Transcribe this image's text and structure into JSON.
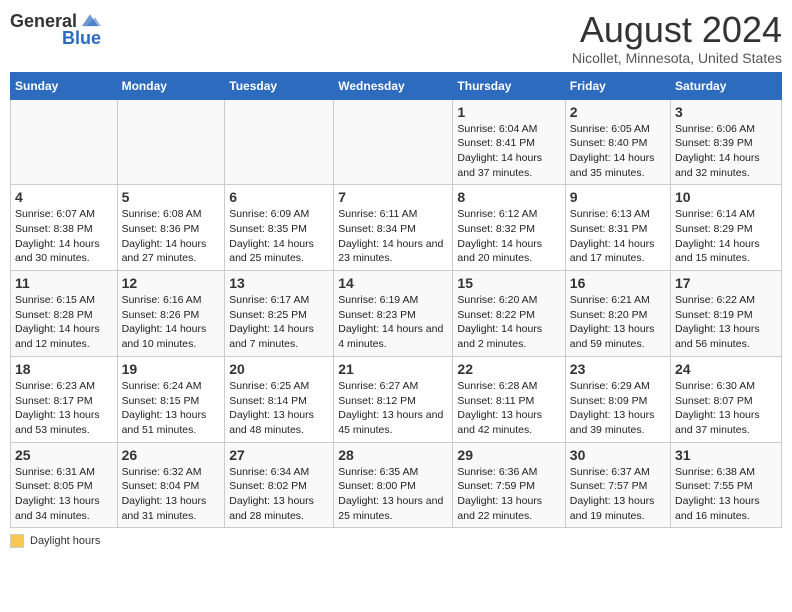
{
  "header": {
    "logo_general": "General",
    "logo_blue": "Blue",
    "title": "August 2024",
    "subtitle": "Nicollet, Minnesota, United States"
  },
  "days_of_week": [
    "Sunday",
    "Monday",
    "Tuesday",
    "Wednesday",
    "Thursday",
    "Friday",
    "Saturday"
  ],
  "weeks": [
    [
      {
        "day": "",
        "info": ""
      },
      {
        "day": "",
        "info": ""
      },
      {
        "day": "",
        "info": ""
      },
      {
        "day": "",
        "info": ""
      },
      {
        "day": "1",
        "info": "Sunrise: 6:04 AM\nSunset: 8:41 PM\nDaylight: 14 hours and 37 minutes."
      },
      {
        "day": "2",
        "info": "Sunrise: 6:05 AM\nSunset: 8:40 PM\nDaylight: 14 hours and 35 minutes."
      },
      {
        "day": "3",
        "info": "Sunrise: 6:06 AM\nSunset: 8:39 PM\nDaylight: 14 hours and 32 minutes."
      }
    ],
    [
      {
        "day": "4",
        "info": "Sunrise: 6:07 AM\nSunset: 8:38 PM\nDaylight: 14 hours and 30 minutes."
      },
      {
        "day": "5",
        "info": "Sunrise: 6:08 AM\nSunset: 8:36 PM\nDaylight: 14 hours and 27 minutes."
      },
      {
        "day": "6",
        "info": "Sunrise: 6:09 AM\nSunset: 8:35 PM\nDaylight: 14 hours and 25 minutes."
      },
      {
        "day": "7",
        "info": "Sunrise: 6:11 AM\nSunset: 8:34 PM\nDaylight: 14 hours and 23 minutes."
      },
      {
        "day": "8",
        "info": "Sunrise: 6:12 AM\nSunset: 8:32 PM\nDaylight: 14 hours and 20 minutes."
      },
      {
        "day": "9",
        "info": "Sunrise: 6:13 AM\nSunset: 8:31 PM\nDaylight: 14 hours and 17 minutes."
      },
      {
        "day": "10",
        "info": "Sunrise: 6:14 AM\nSunset: 8:29 PM\nDaylight: 14 hours and 15 minutes."
      }
    ],
    [
      {
        "day": "11",
        "info": "Sunrise: 6:15 AM\nSunset: 8:28 PM\nDaylight: 14 hours and 12 minutes."
      },
      {
        "day": "12",
        "info": "Sunrise: 6:16 AM\nSunset: 8:26 PM\nDaylight: 14 hours and 10 minutes."
      },
      {
        "day": "13",
        "info": "Sunrise: 6:17 AM\nSunset: 8:25 PM\nDaylight: 14 hours and 7 minutes."
      },
      {
        "day": "14",
        "info": "Sunrise: 6:19 AM\nSunset: 8:23 PM\nDaylight: 14 hours and 4 minutes."
      },
      {
        "day": "15",
        "info": "Sunrise: 6:20 AM\nSunset: 8:22 PM\nDaylight: 14 hours and 2 minutes."
      },
      {
        "day": "16",
        "info": "Sunrise: 6:21 AM\nSunset: 8:20 PM\nDaylight: 13 hours and 59 minutes."
      },
      {
        "day": "17",
        "info": "Sunrise: 6:22 AM\nSunset: 8:19 PM\nDaylight: 13 hours and 56 minutes."
      }
    ],
    [
      {
        "day": "18",
        "info": "Sunrise: 6:23 AM\nSunset: 8:17 PM\nDaylight: 13 hours and 53 minutes."
      },
      {
        "day": "19",
        "info": "Sunrise: 6:24 AM\nSunset: 8:15 PM\nDaylight: 13 hours and 51 minutes."
      },
      {
        "day": "20",
        "info": "Sunrise: 6:25 AM\nSunset: 8:14 PM\nDaylight: 13 hours and 48 minutes."
      },
      {
        "day": "21",
        "info": "Sunrise: 6:27 AM\nSunset: 8:12 PM\nDaylight: 13 hours and 45 minutes."
      },
      {
        "day": "22",
        "info": "Sunrise: 6:28 AM\nSunset: 8:11 PM\nDaylight: 13 hours and 42 minutes."
      },
      {
        "day": "23",
        "info": "Sunrise: 6:29 AM\nSunset: 8:09 PM\nDaylight: 13 hours and 39 minutes."
      },
      {
        "day": "24",
        "info": "Sunrise: 6:30 AM\nSunset: 8:07 PM\nDaylight: 13 hours and 37 minutes."
      }
    ],
    [
      {
        "day": "25",
        "info": "Sunrise: 6:31 AM\nSunset: 8:05 PM\nDaylight: 13 hours and 34 minutes."
      },
      {
        "day": "26",
        "info": "Sunrise: 6:32 AM\nSunset: 8:04 PM\nDaylight: 13 hours and 31 minutes."
      },
      {
        "day": "27",
        "info": "Sunrise: 6:34 AM\nSunset: 8:02 PM\nDaylight: 13 hours and 28 minutes."
      },
      {
        "day": "28",
        "info": "Sunrise: 6:35 AM\nSunset: 8:00 PM\nDaylight: 13 hours and 25 minutes."
      },
      {
        "day": "29",
        "info": "Sunrise: 6:36 AM\nSunset: 7:59 PM\nDaylight: 13 hours and 22 minutes."
      },
      {
        "day": "30",
        "info": "Sunrise: 6:37 AM\nSunset: 7:57 PM\nDaylight: 13 hours and 19 minutes."
      },
      {
        "day": "31",
        "info": "Sunrise: 6:38 AM\nSunset: 7:55 PM\nDaylight: 13 hours and 16 minutes."
      }
    ]
  ],
  "legend": {
    "label": "Daylight hours"
  }
}
